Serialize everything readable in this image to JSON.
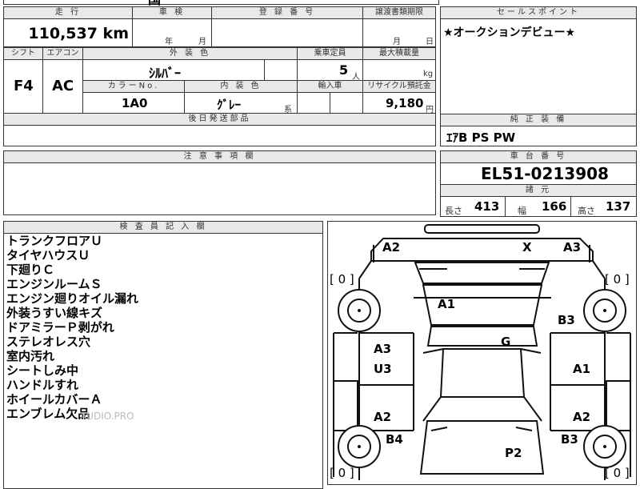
{
  "top_row": {
    "mileage_hdr": "走 行",
    "mileage_value": "110,537 km",
    "inspection_hdr": "車 検",
    "inspection_year_unit": "年",
    "inspection_month_unit": "月",
    "registration_hdr": "登 録 番 号",
    "transfer_hdr": "譲渡書類期限",
    "transfer_month_unit": "月",
    "transfer_day_unit": "日",
    "top_fragment": "国"
  },
  "sales_point": {
    "hdr": "セールスポイント",
    "text": "★オークションデビュー★"
  },
  "spec_row": {
    "shift_hdr": "シフト",
    "shift_value": "F4",
    "ac_hdr": "エアコン",
    "ac_value": "AC",
    "exterior_color_hdr": "外 装 色",
    "exterior_color_value": "ｼﾙﾊﾞｰ",
    "capacity_hdr": "乗車定員",
    "capacity_value": "5",
    "capacity_unit": "人",
    "max_load_hdr": "最大積載量",
    "max_load_unit": "kg",
    "color_no_hdr": "カラーNo.",
    "color_no_value": "1A0",
    "interior_hdr": "内 装 色",
    "interior_value": "ｸﾞﾚｰ",
    "interior_suffix": "系",
    "import_hdr": "輸入車",
    "recycle_hdr": "リサイクル預託金",
    "recycle_value": "9,180",
    "recycle_unit": "円"
  },
  "later_parts": {
    "hdr": "後日発送部品"
  },
  "genuine_equipment": {
    "hdr": "純 正 装 備",
    "value": "ｴｱB PS PW"
  },
  "notes": {
    "hdr": "注 意 事 項 欄"
  },
  "chassis": {
    "hdr": "車 台 番 号",
    "value": "EL51-0213908"
  },
  "specs": {
    "hdr": "諸 元",
    "length_label": "長さ",
    "length_value": "413",
    "width_label": "幅",
    "width_value": "166",
    "height_label": "高さ",
    "height_value": "137"
  },
  "inspector": {
    "hdr": "検 査 員 記 入 欄",
    "lines": [
      "トランクフロアＵ",
      "タイヤハウスＵ",
      "下廻りＣ",
      "エンジンルームＳ",
      "エンジン廻りオイル漏れ",
      "外装うすい線キズ",
      "ドアミラーＰ剥がれ",
      "ステレオレス穴",
      "室内汚れ",
      "シートしみ中",
      "ハンドルすれ",
      "ホイールカバーＡ",
      "エンブレム欠品"
    ]
  },
  "diagram": {
    "labels": {
      "rear_left": "A2",
      "rear_x": "X",
      "rear_right": "A3",
      "roof": "A1",
      "right_rear_fender": "B3",
      "center": "G",
      "left_rear_door_top": "A3",
      "left_rear_door_bottom": "U3",
      "right_rear_door": "A1",
      "left_front_door": "A2",
      "right_front_door": "A2",
      "left_front_fender": "B4",
      "right_front_fender": "B3",
      "hood": "P2",
      "tire_tl": "[ 0 ]",
      "tire_tr": "[ 0 ]",
      "tire_bl": "[ 0 ]",
      "tire_br": "[ 0 ]"
    },
    "watermark": "AUDIO.PRO"
  }
}
